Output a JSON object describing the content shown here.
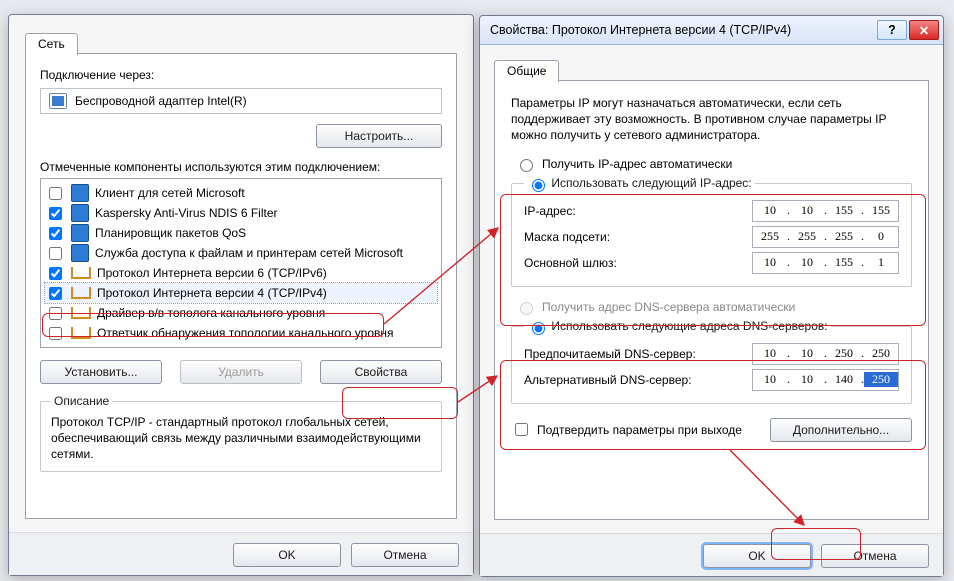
{
  "win1": {
    "tab_label": "Сеть",
    "connect_via_label": "Подключение через:",
    "adapter": "Беспроводной адаптер Intel(R)",
    "configure_btn": "Настроить...",
    "components_label": "Отмеченные компоненты используются этим подключением:",
    "items": [
      {
        "checked": false,
        "label": "Клиент для сетей Microsoft",
        "ico": "v1"
      },
      {
        "checked": true,
        "label": "Kaspersky Anti-Virus NDIS 6 Filter",
        "ico": "v1"
      },
      {
        "checked": true,
        "label": "Планировщик пакетов QoS",
        "ico": "v1"
      },
      {
        "checked": false,
        "label": "Служба доступа к файлам и принтерам сетей Microsoft",
        "ico": "v1"
      },
      {
        "checked": true,
        "label": "Протокол Интернета версии 6 (TCP/IPv6)",
        "ico": "c"
      },
      {
        "checked": true,
        "label": "Протокол Интернета версии 4 (TCP/IPv4)",
        "ico": "c"
      },
      {
        "checked": false,
        "label": "Драйвер в/в тополога канального уровня",
        "ico": "c"
      },
      {
        "checked": false,
        "label": "Ответчик обнаружения топологии канального уровня",
        "ico": "c"
      }
    ],
    "install_btn": "Установить...",
    "remove_btn": "Удалить",
    "properties_btn": "Свойства",
    "desc_group_label": "Описание",
    "desc_text": "Протокол TCP/IP - стандартный протокол глобальных сетей, обеспечивающий связь между различными взаимодействующими сетями.",
    "ok": "OK",
    "cancel": "Отмена"
  },
  "win2": {
    "title": "Свойства: Протокол Интернета версии 4 (TCP/IPv4)",
    "tab_label": "Общие",
    "intro": "Параметры IP могут назначаться автоматически, если сеть поддерживает эту возможность. В противном случае параметры IP можно получить у сетевого администратора.",
    "radio_ip_auto": "Получить IP-адрес автоматически",
    "radio_ip_manual": "Использовать следующий IP-адрес:",
    "ip_label": "IP-адрес:",
    "ip_value": [
      "10",
      "10",
      "155",
      "155"
    ],
    "mask_label": "Маска подсети:",
    "mask_value": [
      "255",
      "255",
      "255",
      "0"
    ],
    "gw_label": "Основной шлюз:",
    "gw_value": [
      "10",
      "10",
      "155",
      "1"
    ],
    "radio_dns_auto": "Получить адрес DNS-сервера автоматически",
    "radio_dns_manual": "Использовать следующие адреса DNS-серверов:",
    "dns1_label": "Предпочитаемый DNS-сервер:",
    "dns1_value": [
      "10",
      "10",
      "250",
      "250"
    ],
    "dns2_label": "Альтернативный DNS-сервер:",
    "dns2_value": [
      "10",
      "10",
      "140",
      "250"
    ],
    "validate_checkbox": "Подтвердить параметры при выходе",
    "advanced_btn": "Дополнительно...",
    "ok": "OK",
    "cancel": "Отмена"
  }
}
